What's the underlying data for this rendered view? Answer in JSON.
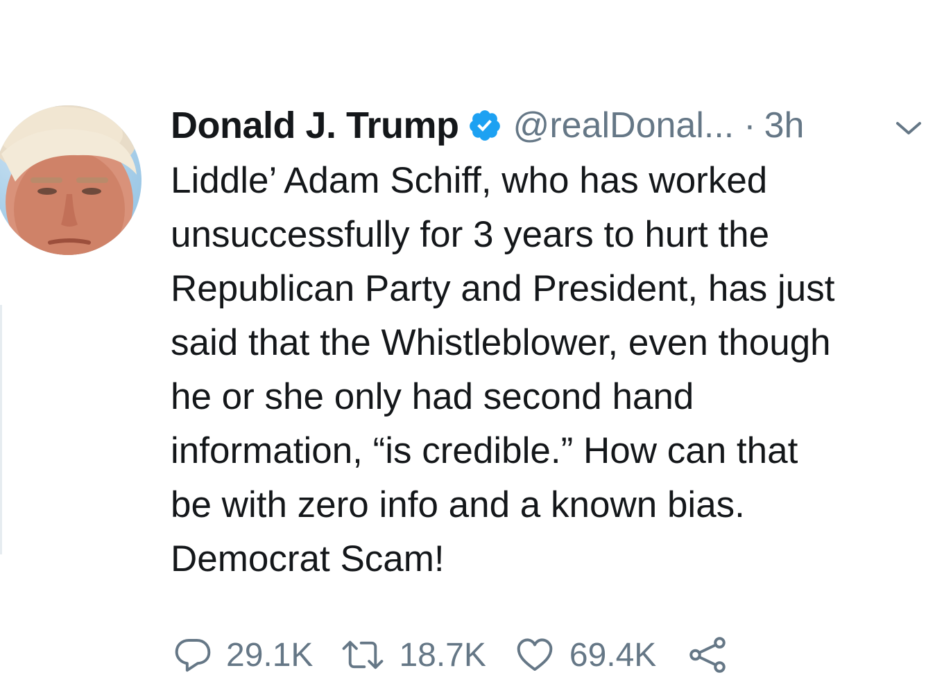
{
  "tweet": {
    "author": {
      "name": "Donald J. Trump",
      "handle": "@realDonal...",
      "verified": true,
      "avatar_icon": "profile-photo"
    },
    "separator": "·",
    "time": "3h",
    "text_lines": [
      "Liddle’ Adam Schiff, who has worked",
      "unsuccessfully for 3 years to hurt the",
      "Republican Party and President, has just",
      "said that the Whistleblower, even though",
      "he or she only had second hand",
      "information, “is credible.” How can that",
      "be with zero info and a known bias.",
      "Democrat Scam!"
    ],
    "actions": {
      "reply": {
        "icon": "reply-icon",
        "count": "29.1K"
      },
      "retweet": {
        "icon": "retweet-icon",
        "count": "18.7K"
      },
      "like": {
        "icon": "heart-icon",
        "count": "69.4K"
      },
      "share": {
        "icon": "share-icon"
      }
    }
  },
  "colors": {
    "text_primary": "#14171a",
    "text_secondary": "#657786",
    "verified_blue": "#1da1f2"
  }
}
